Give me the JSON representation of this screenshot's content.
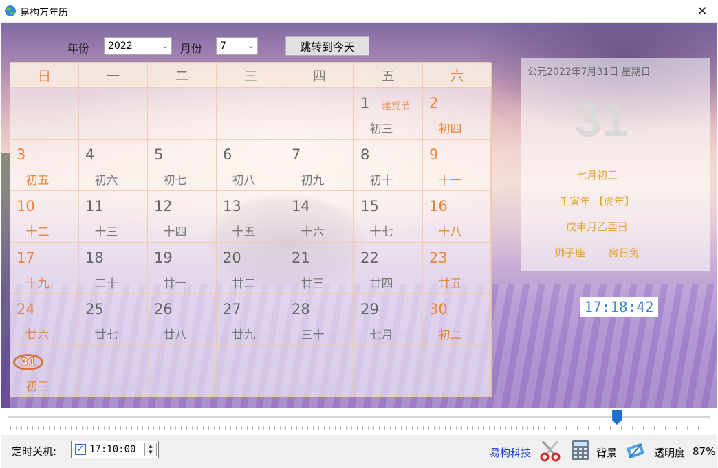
{
  "window": {
    "title": "易构万年历",
    "close_glyph": "✕"
  },
  "controls": {
    "year_label": "年份",
    "year_value": "2022",
    "month_label": "月份",
    "month_value": "7",
    "today_button": "跳转到今天"
  },
  "weekdays": [
    "日",
    "一",
    "二",
    "三",
    "四",
    "五",
    "六"
  ],
  "calendar": {
    "weeks": [
      [
        {
          "num": "",
          "lunar": ""
        },
        {
          "num": "",
          "lunar": ""
        },
        {
          "num": "",
          "lunar": ""
        },
        {
          "num": "",
          "lunar": ""
        },
        {
          "num": "",
          "lunar": ""
        },
        {
          "num": "1",
          "lunar": "初三",
          "festival": "建党节"
        },
        {
          "num": "2",
          "lunar": "初四"
        }
      ],
      [
        {
          "num": "3",
          "lunar": "初五"
        },
        {
          "num": "4",
          "lunar": "初六"
        },
        {
          "num": "5",
          "lunar": "初七"
        },
        {
          "num": "6",
          "lunar": "初八"
        },
        {
          "num": "7",
          "lunar": "初九"
        },
        {
          "num": "8",
          "lunar": "初十"
        },
        {
          "num": "9",
          "lunar": "十一"
        }
      ],
      [
        {
          "num": "10",
          "lunar": "十二"
        },
        {
          "num": "11",
          "lunar": "十三"
        },
        {
          "num": "12",
          "lunar": "十四"
        },
        {
          "num": "13",
          "lunar": "十五"
        },
        {
          "num": "14",
          "lunar": "十六"
        },
        {
          "num": "15",
          "lunar": "十七"
        },
        {
          "num": "16",
          "lunar": "十八"
        }
      ],
      [
        {
          "num": "17",
          "lunar": "十九"
        },
        {
          "num": "18",
          "lunar": "二十"
        },
        {
          "num": "19",
          "lunar": "廿一"
        },
        {
          "num": "20",
          "lunar": "廿二"
        },
        {
          "num": "21",
          "lunar": "廿三"
        },
        {
          "num": "22",
          "lunar": "廿四"
        },
        {
          "num": "23",
          "lunar": "廿五"
        }
      ],
      [
        {
          "num": "24",
          "lunar": "廿六"
        },
        {
          "num": "25",
          "lunar": "廿七"
        },
        {
          "num": "26",
          "lunar": "廿八"
        },
        {
          "num": "27",
          "lunar": "廿九"
        },
        {
          "num": "28",
          "lunar": "三十"
        },
        {
          "num": "29",
          "lunar": "七月"
        },
        {
          "num": "30",
          "lunar": "初二"
        }
      ],
      [
        {
          "num": "31",
          "lunar": "初三",
          "today": true
        },
        {
          "num": "",
          "lunar": ""
        },
        {
          "num": "",
          "lunar": ""
        },
        {
          "num": "",
          "lunar": ""
        },
        {
          "num": "",
          "lunar": ""
        },
        {
          "num": "",
          "lunar": ""
        },
        {
          "num": "",
          "lunar": ""
        }
      ]
    ]
  },
  "info": {
    "full_date": "公元2022年7月31日 星期日",
    "big_day": "31",
    "lunar_date": "七月初三",
    "ganzhi_year": "壬寅年 【虎年】",
    "ganzhi_day": "戊申月乙酉日",
    "constellation": "狮子座",
    "mansion": "房日兔"
  },
  "clock": "17:18:42",
  "slider": {
    "value_fraction": 0.87
  },
  "bottom": {
    "shutdown_label": "定时关机:",
    "shutdown_checked": true,
    "shutdown_time": "17:10:00",
    "brand_link": "易构科技",
    "background_label": "背景",
    "opacity_label": "透明度",
    "opacity_value": "87%"
  },
  "colors": {
    "weekend_accent": "#e8843a",
    "lunar_info": "#e0a630",
    "clock_text": "#3a86d0",
    "link_blue": "#1a3dd6",
    "slider_thumb": "#1e6fd0"
  },
  "icons": {
    "app": "globe-app-icon",
    "scissors": "scissors-icon",
    "calculator": "calculator-icon",
    "paintbrush": "paint-brush-icon"
  }
}
